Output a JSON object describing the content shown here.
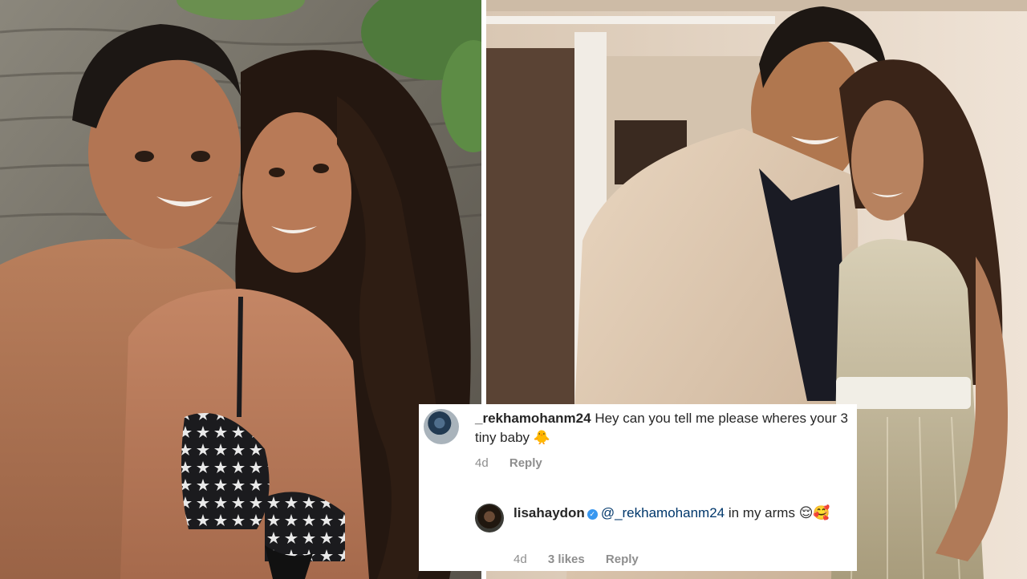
{
  "comments": [
    {
      "username": "_rekhamohanm24",
      "text": "Hey can you tell me please wheres your 3 tiny baby",
      "emoji": "🐥",
      "time": "4d",
      "reply_label": "Reply"
    },
    {
      "username": "lisahaydon",
      "verified": true,
      "mention": "@_rekhamohanm24",
      "text": "in my arms",
      "emoji": "😌🥰",
      "time": "4d",
      "likes": "3 likes",
      "reply_label": "Reply"
    }
  ],
  "colors": {
    "mention": "#00376b",
    "meta_gray": "#8e8e8e",
    "verified_blue": "#3897f0"
  }
}
